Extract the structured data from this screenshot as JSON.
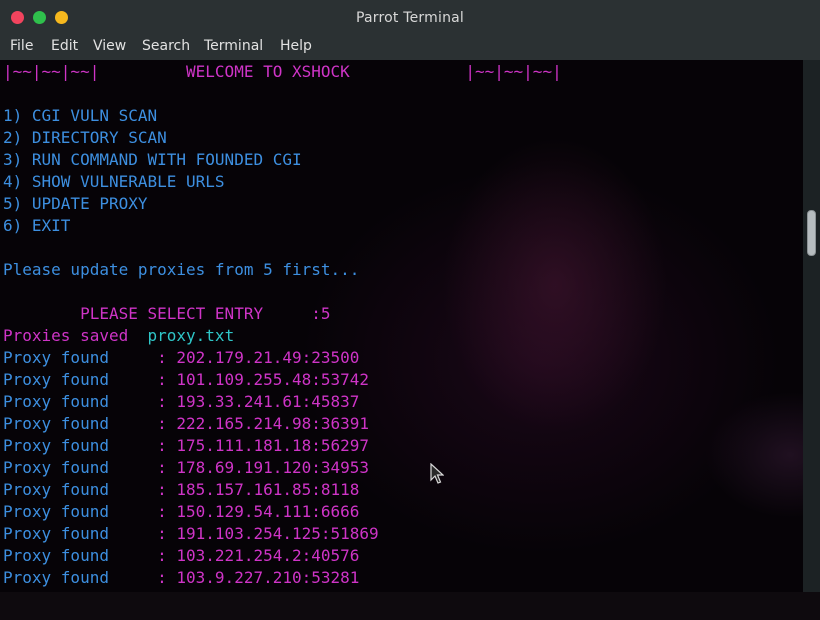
{
  "window": {
    "title": "Parrot Terminal"
  },
  "menu": [
    "File",
    "Edit",
    "View",
    "Search",
    "Terminal",
    "Help"
  ],
  "terminal": {
    "banner": "|~~|~~|~~|         WELCOME TO XSHOCK            |~~|~~|~~|",
    "options": [
      "1) CGI VULN SCAN",
      "2) DIRECTORY SCAN",
      "3) RUN COMMAND WITH FOUNDED CGI",
      "4) SHOW VULNERABLE URLS",
      "5) UPDATE PROXY",
      "6) EXIT"
    ],
    "notice": "Please update proxies from 5 first...",
    "prompt": "        PLEASE SELECT ENTRY     :5",
    "saved_label": "Proxies saved",
    "saved_file": "proxy.txt",
    "proxy_label": "Proxy found     ",
    "proxies": [
      ": 202.179.21.49:23500",
      ": 101.109.255.48:53742",
      ": 193.33.241.61:45837",
      ": 222.165.214.98:36391",
      ": 175.111.181.18:56297",
      ": 178.69.191.120:34953",
      ": 185.157.161.85:8118",
      ": 150.129.54.111:6666",
      ": 191.103.254.125:51869",
      ": 103.221.254.2:40576",
      ": 103.9.227.210:53281"
    ]
  },
  "colors": {
    "magenta": "#cf34c7",
    "blue": "#3d8fe0",
    "cyan": "#2fc6c8"
  }
}
